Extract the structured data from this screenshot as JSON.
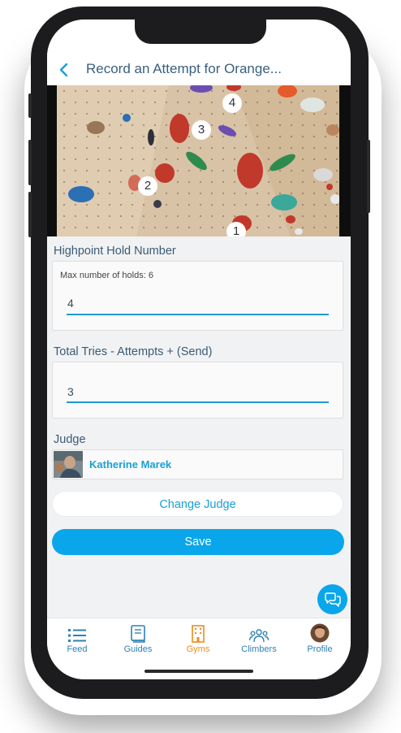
{
  "header": {
    "title": "Record an Attempt for Orange...",
    "back_icon": "chevron-left-icon"
  },
  "route_photo": {
    "hold_markers": [
      "4",
      "3",
      "2",
      "1"
    ]
  },
  "highpoint": {
    "label": "Highpoint Hold Number",
    "hint": "Max number of holds: 6",
    "value": "4"
  },
  "tries": {
    "label": "Total Tries - Attempts + (Send)",
    "value": "3"
  },
  "judge": {
    "label": "Judge",
    "name": "Katherine Marek"
  },
  "buttons": {
    "change_judge": "Change Judge",
    "save": "Save"
  },
  "colors": {
    "accent": "#0aa6ec",
    "active_tab": "#f08a1c",
    "tab_text": "#2d82b7"
  },
  "tabs": [
    {
      "label": "Feed",
      "icon": "list-icon"
    },
    {
      "label": "Guides",
      "icon": "book-icon"
    },
    {
      "label": "Gyms",
      "icon": "building-icon",
      "active": true
    },
    {
      "label": "Climbers",
      "icon": "people-icon"
    },
    {
      "label": "Profile",
      "icon": "avatar"
    }
  ]
}
